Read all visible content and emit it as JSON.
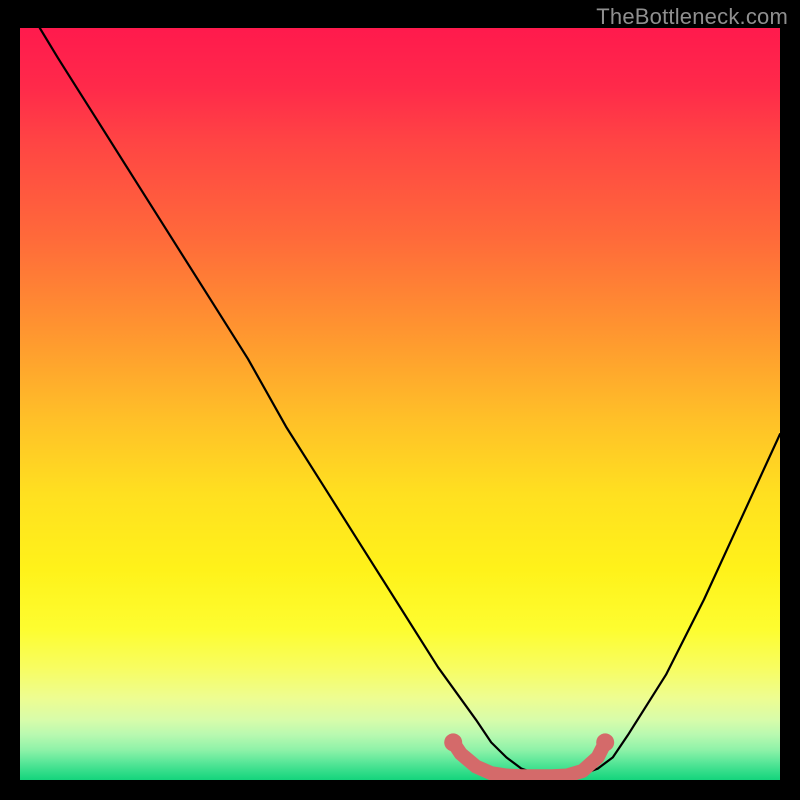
{
  "watermark": "TheBottleneck.com",
  "chart_data": {
    "type": "line",
    "title": "",
    "xlabel": "",
    "ylabel": "",
    "xlim": [
      0,
      100
    ],
    "ylim": [
      0,
      100
    ],
    "background_gradient": {
      "top": "#ff1a4d",
      "middle": "#ffe020",
      "bottom": "#14d47c"
    },
    "series": [
      {
        "name": "bottleneck-curve",
        "color": "#000000",
        "x": [
          2.6,
          5,
          7.5,
          10,
          15,
          20,
          25,
          30,
          35,
          40,
          45,
          50,
          55,
          60,
          62,
          64,
          66,
          68,
          70,
          72,
          74,
          76,
          78,
          80,
          85,
          90,
          95,
          100
        ],
        "y": [
          100,
          96,
          92,
          88,
          80,
          72,
          64,
          56,
          47,
          39,
          31,
          23,
          15,
          8,
          5,
          3,
          1.5,
          0.8,
          0.5,
          0.5,
          0.8,
          1.5,
          3,
          6,
          14,
          24,
          35,
          46
        ]
      },
      {
        "name": "optimal-region-marker",
        "color": "#d46a6a",
        "x": [
          57,
          58,
          60,
          62,
          64,
          66,
          68,
          70,
          72,
          74,
          76,
          77
        ],
        "y": [
          5,
          3.5,
          1.8,
          0.9,
          0.6,
          0.5,
          0.5,
          0.5,
          0.6,
          1.2,
          3,
          5
        ]
      }
    ],
    "marker_endpoints": {
      "left": {
        "x": 57,
        "y": 5
      },
      "right": {
        "x": 77,
        "y": 5
      }
    }
  }
}
